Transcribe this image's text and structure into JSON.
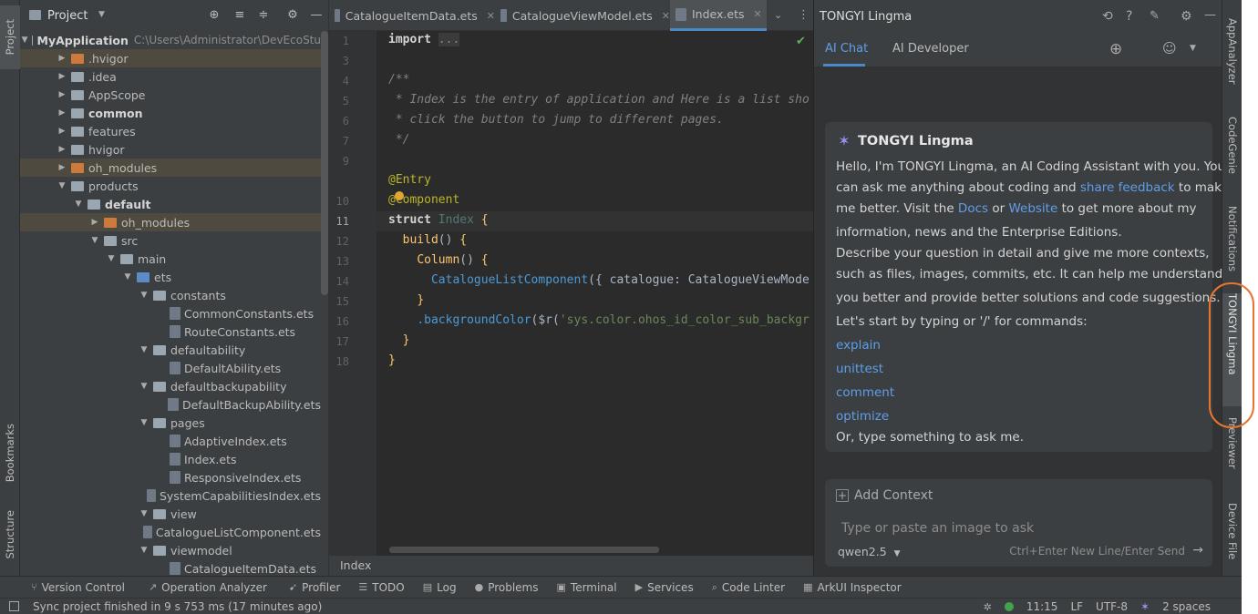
{
  "left_strip": {
    "project": "Project",
    "bookmarks": "Bookmarks",
    "structure": "Structure"
  },
  "project_panel": {
    "title": "Project",
    "tree": [
      {
        "label": "MyApplication",
        "path": "C:\\Users\\Administrator\\DevEcoStu",
        "depth": 0,
        "expanded": true,
        "kind": "module",
        "bold": true
      },
      {
        "label": ".hvigor",
        "depth": 1,
        "expanded": false,
        "kind": "folder-orange",
        "highlight": true
      },
      {
        "label": ".idea",
        "depth": 1,
        "expanded": false,
        "kind": "folder"
      },
      {
        "label": "AppScope",
        "depth": 1,
        "expanded": false,
        "kind": "folder"
      },
      {
        "label": "common",
        "depth": 1,
        "expanded": false,
        "kind": "module",
        "bold": true
      },
      {
        "label": "features",
        "depth": 1,
        "expanded": false,
        "kind": "folder"
      },
      {
        "label": "hvigor",
        "depth": 1,
        "expanded": false,
        "kind": "folder"
      },
      {
        "label": "oh_modules",
        "depth": 1,
        "expanded": false,
        "kind": "folder-orange",
        "highlight": true
      },
      {
        "label": "products",
        "depth": 1,
        "expanded": true,
        "kind": "folder"
      },
      {
        "label": "default",
        "depth": 2,
        "expanded": true,
        "kind": "module",
        "bold": true
      },
      {
        "label": "oh_modules",
        "depth": 3,
        "expanded": false,
        "kind": "folder-orange",
        "highlight": true
      },
      {
        "label": "src",
        "depth": 3,
        "expanded": true,
        "kind": "folder"
      },
      {
        "label": "main",
        "depth": 4,
        "expanded": true,
        "kind": "folder"
      },
      {
        "label": "ets",
        "depth": 5,
        "expanded": true,
        "kind": "folder-blue"
      },
      {
        "label": "constants",
        "depth": 6,
        "expanded": true,
        "kind": "folder"
      },
      {
        "label": "CommonConstants.ets",
        "depth": 7,
        "kind": "file"
      },
      {
        "label": "RouteConstants.ets",
        "depth": 7,
        "kind": "file"
      },
      {
        "label": "defaultability",
        "depth": 6,
        "expanded": true,
        "kind": "folder"
      },
      {
        "label": "DefaultAbility.ets",
        "depth": 7,
        "kind": "file"
      },
      {
        "label": "defaultbackupability",
        "depth": 6,
        "expanded": true,
        "kind": "folder"
      },
      {
        "label": "DefaultBackupAbility.ets",
        "depth": 7,
        "kind": "file"
      },
      {
        "label": "pages",
        "depth": 6,
        "expanded": true,
        "kind": "folder"
      },
      {
        "label": "AdaptiveIndex.ets",
        "depth": 7,
        "kind": "file"
      },
      {
        "label": "Index.ets",
        "depth": 7,
        "kind": "file"
      },
      {
        "label": "ResponsiveIndex.ets",
        "depth": 7,
        "kind": "file"
      },
      {
        "label": "SystemCapabilitiesIndex.ets",
        "depth": 7,
        "kind": "file"
      },
      {
        "label": "view",
        "depth": 6,
        "expanded": true,
        "kind": "folder"
      },
      {
        "label": "CatalogueListComponent.ets",
        "depth": 7,
        "kind": "file"
      },
      {
        "label": "viewmodel",
        "depth": 6,
        "expanded": true,
        "kind": "folder"
      },
      {
        "label": "CatalogueItemData.ets",
        "depth": 7,
        "kind": "file"
      }
    ]
  },
  "editor": {
    "tabs": [
      {
        "label": "CatalogueItemData.ets",
        "active": false
      },
      {
        "label": "CatalogueViewModel.ets",
        "active": false
      },
      {
        "label": "Index.ets",
        "active": true
      }
    ],
    "line_numbers": [
      "1",
      "3",
      "4",
      "5",
      "6",
      "7",
      "9",
      "10",
      "11",
      "12",
      "13",
      "14",
      "15",
      "16",
      "17",
      "18"
    ],
    "current_line": "11",
    "breadcrumb": "Index"
  },
  "lingma": {
    "panel_title": "TONGYI Lingma",
    "tabs": [
      "AI Chat",
      "AI Developer"
    ],
    "welcome": {
      "title": "TONGYI Lingma",
      "line1": "Hello, I'm TONGYI Lingma, an AI Coding Assistant with you. You",
      "line2_pre": "can ask me anything about coding and ",
      "line2_link": "share feedback",
      "line2_post": " to make",
      "line3_pre": "me better. Visit the ",
      "line3_link1": "Docs",
      "line3_mid": " or ",
      "line3_link2": "Website",
      "line3_post": " to get more about my",
      "line4": "information, news and the Enterprise Editions.",
      "line5": "Describe your question in detail and give me more contexts,",
      "line6": "such as files, images, commits, etc. It can help me understand",
      "line7": "you better and provide better solutions and code suggestions.",
      "line8": "Let's start by typing or '/' for commands:",
      "commands": [
        "explain",
        "unittest",
        "comment",
        "optimize"
      ],
      "closing": "Or, type something to ask me."
    },
    "input": {
      "add_context": "Add Context",
      "placeholder": "Type or paste an image to ask",
      "model": "qwen2.5",
      "hint": "Ctrl+Enter New Line/Enter Send"
    }
  },
  "right_strip": {
    "tabs": [
      "AppAnalyzer",
      "CodeGenie",
      "Notifications",
      "TONGYI Lingma",
      "Previewer",
      "Device File"
    ]
  },
  "bottom_tools": [
    "Version Control",
    "Operation Analyzer",
    "Profiler",
    "TODO",
    "Log",
    "Problems",
    "Terminal",
    "Services",
    "Code Linter",
    "ArkUI Inspector"
  ],
  "status_bar": {
    "message": "Sync project finished in 9 s 753 ms (17 minutes ago)",
    "time": "11:15",
    "line_sep": "LF",
    "encoding": "UTF-8",
    "indent": "2 spaces"
  },
  "colors": {
    "accent": "#4a88c7",
    "link": "#5e9ee8",
    "highlight_ring": "#e8752f"
  }
}
